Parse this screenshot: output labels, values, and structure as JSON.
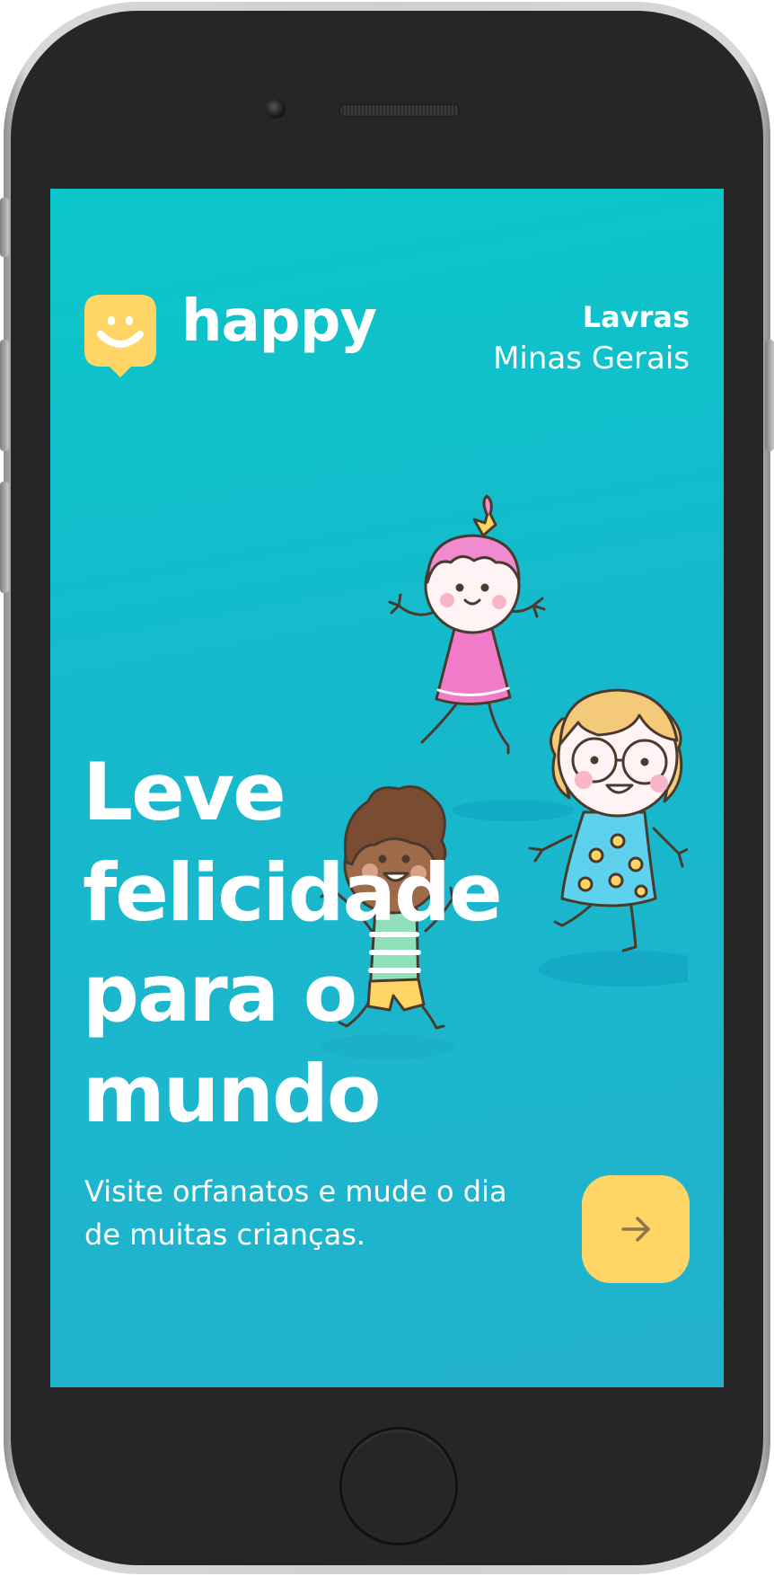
{
  "brand": {
    "name": "happy",
    "icon": "smiley-chat-bubble-icon",
    "icon_color": "#ffd666"
  },
  "location": {
    "city": "Lavras",
    "state": "Minas Gerais"
  },
  "hero": {
    "title_lines": [
      "Leve",
      "felicidade",
      "para o",
      "mundo"
    ],
    "subtitle": "Visite orfanatos e mude o dia de muitas crianças."
  },
  "cta": {
    "icon": "arrow-right-icon",
    "background": "#ffd666",
    "icon_color": "#8d734b"
  },
  "theme": {
    "background_start": "#0bc6c9",
    "background_end": "#23b2ce",
    "text": "#ffffff"
  }
}
